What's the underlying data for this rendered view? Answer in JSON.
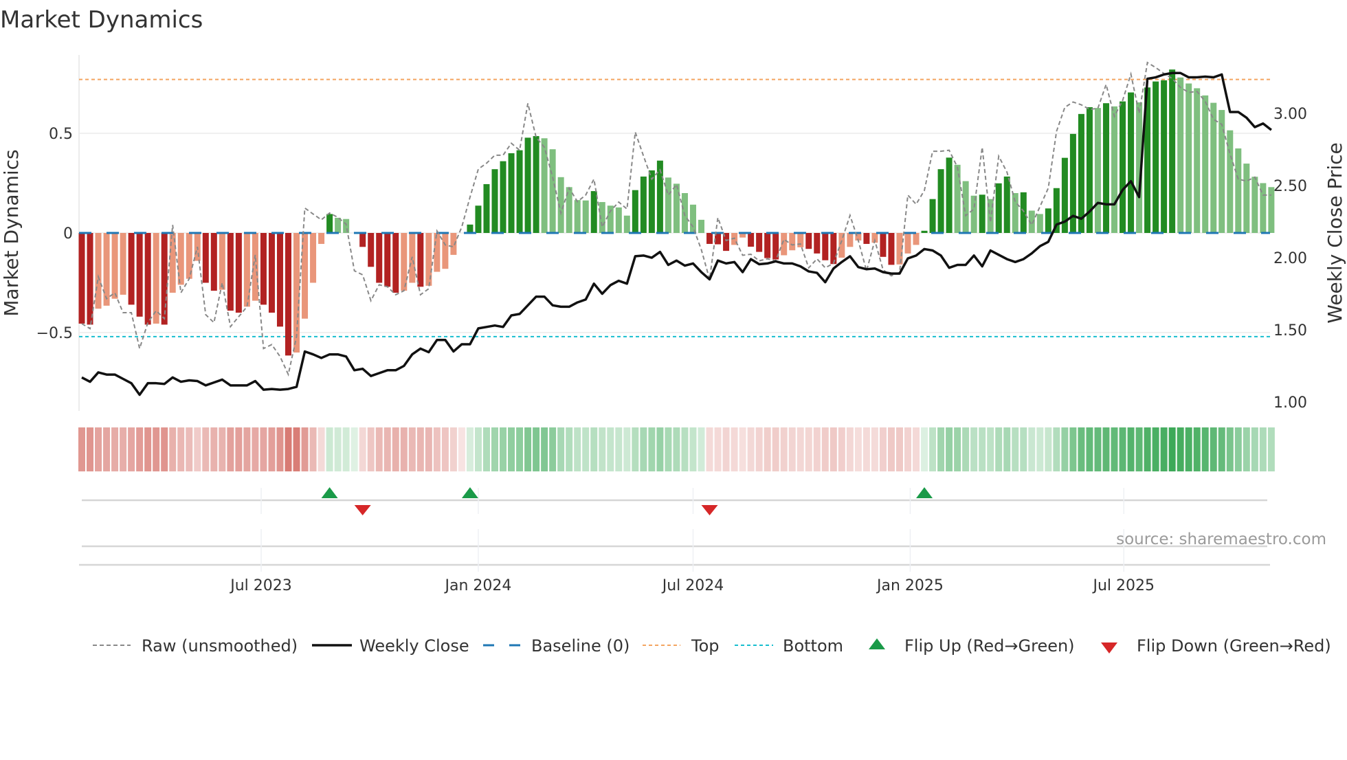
{
  "chart_data": {
    "type": "bar",
    "title": "Market Dynamics",
    "ylabel": "Market Dynamics",
    "y2label": "Weekly Close Price",
    "x_start": "2023-01-30",
    "x_step_days": 7,
    "ylim": [
      -0.893,
      0.893
    ],
    "y2lim": [
      0.938,
      3.405
    ],
    "yticks": [
      {
        "v": 0.5,
        "label": "0.5"
      },
      {
        "v": 0,
        "label": "0"
      },
      {
        "v": -0.5,
        "label": "−0.5"
      }
    ],
    "y2ticks": [
      {
        "v": 1.0,
        "label": "1.00"
      },
      {
        "v": 1.5,
        "label": "1.50"
      },
      {
        "v": 2.0,
        "label": "2.00"
      },
      {
        "v": 2.5,
        "label": "2.50"
      },
      {
        "v": 3.0,
        "label": "3.00"
      }
    ],
    "xticks": [
      {
        "date": "2023-07-01",
        "label": "Jul 2023"
      },
      {
        "date": "2024-01-01",
        "label": "Jan 2024"
      },
      {
        "date": "2024-07-01",
        "label": "Jul 2024"
      },
      {
        "date": "2025-01-01",
        "label": "Jan 2025"
      },
      {
        "date": "2025-07-01",
        "label": "Jul 2025"
      }
    ],
    "top_level": 0.77,
    "bottom_level": -0.52,
    "baseline": 0,
    "smoothed": [
      -0.455,
      -0.46,
      -0.38,
      -0.365,
      -0.33,
      -0.31,
      -0.36,
      -0.42,
      -0.46,
      -0.455,
      -0.46,
      -0.3,
      -0.26,
      -0.23,
      -0.14,
      -0.25,
      -0.29,
      -0.285,
      -0.39,
      -0.4,
      -0.37,
      -0.34,
      -0.36,
      -0.4,
      -0.47,
      -0.615,
      -0.6,
      -0.43,
      -0.25,
      -0.055,
      0.095,
      0.076,
      0.07,
      0,
      -0.07,
      -0.17,
      -0.25,
      -0.27,
      -0.3,
      -0.29,
      -0.25,
      -0.27,
      -0.265,
      -0.195,
      -0.18,
      -0.11,
      0,
      0.042,
      0.137,
      0.245,
      0.32,
      0.36,
      0.4,
      0.415,
      0.478,
      0.486,
      0.475,
      0.42,
      0.28,
      0.23,
      0.165,
      0.163,
      0.21,
      0.155,
      0.137,
      0.128,
      0.087,
      0.215,
      0.283,
      0.314,
      0.363,
      0.278,
      0.247,
      0.2,
      0.142,
      0.066,
      -0.055,
      -0.057,
      -0.09,
      -0.06,
      -0.023,
      -0.069,
      -0.095,
      -0.126,
      -0.133,
      -0.112,
      -0.087,
      -0.072,
      -0.08,
      -0.103,
      -0.137,
      -0.156,
      -0.124,
      -0.07,
      -0.038,
      -0.055,
      -0.049,
      -0.12,
      -0.16,
      -0.158,
      -0.103,
      -0.06,
      0.011,
      0.17,
      0.32,
      0.378,
      0.342,
      0.26,
      0.187,
      0.192,
      0.17,
      0.249,
      0.283,
      0.2,
      0.204,
      0.112,
      0.095,
      0.123,
      0.225,
      0.377,
      0.497,
      0.597,
      0.631,
      0.627,
      0.651,
      0.635,
      0.66,
      0.705,
      0.655,
      0.73,
      0.76,
      0.766,
      0.82,
      0.78,
      0.75,
      0.726,
      0.69,
      0.653,
      0.617,
      0.515,
      0.424,
      0.348,
      0.282,
      0.25,
      0.23
    ],
    "raw": [
      -0.455,
      -0.48,
      -0.22,
      -0.33,
      -0.3,
      -0.4,
      -0.4,
      -0.58,
      -0.45,
      -0.39,
      -0.43,
      0.04,
      -0.3,
      -0.23,
      -0.07,
      -0.41,
      -0.45,
      -0.25,
      -0.47,
      -0.42,
      -0.37,
      -0.11,
      -0.58,
      -0.56,
      -0.62,
      -0.71,
      -0.52,
      0.125,
      0.095,
      0.066,
      0.1,
      0.078,
      0.044,
      -0.19,
      -0.21,
      -0.34,
      -0.26,
      -0.27,
      -0.31,
      -0.29,
      -0.12,
      -0.31,
      -0.28,
      0.01,
      -0.06,
      -0.07,
      0.03,
      0.18,
      0.32,
      0.35,
      0.39,
      0.39,
      0.45,
      0.415,
      0.65,
      0.48,
      0.43,
      0.28,
      0.1,
      0.225,
      0.157,
      0.19,
      0.27,
      0.03,
      0.11,
      0.155,
      0.12,
      0.506,
      0.386,
      0.27,
      0.317,
      0.19,
      0.243,
      0.088,
      0.03,
      -0.084,
      -0.233,
      0.077,
      -0.038,
      -0.026,
      -0.112,
      -0.107,
      -0.14,
      -0.13,
      -0.14,
      -0.032,
      -0.06,
      -0.055,
      -0.175,
      -0.13,
      -0.175,
      -0.152,
      -0.038,
      0.088,
      -0.038,
      -0.19,
      -0.038,
      -0.185,
      -0.215,
      -0.198,
      0.19,
      0.144,
      0.213,
      0.41,
      0.41,
      0.415,
      0.33,
      0.087,
      0.12,
      0.43,
      0.053,
      0.385,
      0.305,
      0.156,
      0.11,
      0.04,
      0.133,
      0.225,
      0.51,
      0.63,
      0.657,
      0.643,
      0.62,
      0.625,
      0.745,
      0.585,
      0.665,
      0.797,
      0.6,
      0.855,
      0.83,
      0.8,
      0.775,
      0.73,
      0.705,
      0.71,
      0.66,
      0.57,
      0.545,
      0.396,
      0.27,
      0.26,
      0.28,
      0.19,
      0.19
    ],
    "weekly_close": [
      1.17,
      1.14,
      1.205,
      1.19,
      1.19,
      1.16,
      1.13,
      1.05,
      1.13,
      1.13,
      1.125,
      1.17,
      1.14,
      1.15,
      1.145,
      1.115,
      1.135,
      1.155,
      1.115,
      1.115,
      1.115,
      1.145,
      1.085,
      1.09,
      1.085,
      1.09,
      1.105,
      1.35,
      1.33,
      1.305,
      1.33,
      1.33,
      1.315,
      1.22,
      1.23,
      1.18,
      1.2,
      1.22,
      1.22,
      1.25,
      1.33,
      1.37,
      1.345,
      1.43,
      1.43,
      1.35,
      1.4,
      1.4,
      1.51,
      1.52,
      1.53,
      1.52,
      1.6,
      1.61,
      1.67,
      1.73,
      1.73,
      1.67,
      1.66,
      1.66,
      1.69,
      1.71,
      1.82,
      1.75,
      1.81,
      1.84,
      1.82,
      2.01,
      2.015,
      2.0,
      2.04,
      1.95,
      1.98,
      1.945,
      1.96,
      1.9,
      1.85,
      1.98,
      1.96,
      1.97,
      1.9,
      1.99,
      1.955,
      1.96,
      1.975,
      1.96,
      1.96,
      1.94,
      1.905,
      1.895,
      1.83,
      1.925,
      1.97,
      2.01,
      1.935,
      1.92,
      1.925,
      1.9,
      1.89,
      1.89,
      1.995,
      2.015,
      2.06,
      2.05,
      2.015,
      1.93,
      1.95,
      1.95,
      2.015,
      1.94,
      2.05,
      2.02,
      1.99,
      1.97,
      1.99,
      2.03,
      2.08,
      2.11,
      2.23,
      2.25,
      2.29,
      2.27,
      2.32,
      2.38,
      2.37,
      2.37,
      2.47,
      2.53,
      2.42,
      3.24,
      3.25,
      3.27,
      3.28,
      3.28,
      3.25,
      3.25,
      3.255,
      3.25,
      3.27,
      3.01,
      3.01,
      2.97,
      2.905,
      2.93,
      2.885
    ],
    "flips_up_week_index": [
      30,
      47,
      102
    ],
    "flips_down_week_index": [
      34,
      76
    ],
    "legend": {
      "position": "bottom",
      "raw": "Raw (unsmoothed)",
      "close": "Weekly Close",
      "baseline": "Baseline (0)",
      "top": "Top",
      "bottom": "Bottom",
      "flip_up": "Flip Up (Red→Green)",
      "flip_down": "Flip Down (Green→Red)"
    },
    "source": "source: sharemaestro.com",
    "colors": {
      "dark_red": "#b22222",
      "light_red": "#e9967a",
      "dark_green": "#228b22",
      "light_green": "#7fbf7f",
      "raw": "#888888",
      "close": "#111111",
      "baseline": "#1f77b4",
      "top": "#f4a460",
      "bottom": "#17becf",
      "flip_up": "#1a9a48",
      "flip_down": "#d62728"
    }
  }
}
